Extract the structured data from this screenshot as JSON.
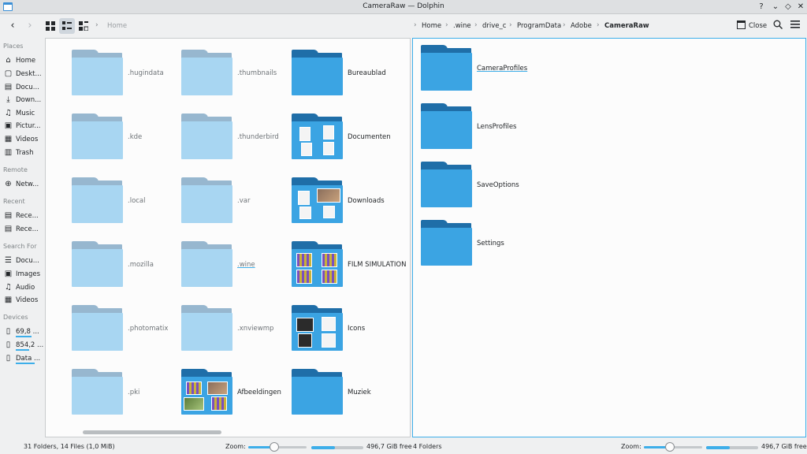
{
  "window": {
    "title": "CameraRaw — Dolphin",
    "buttons": [
      "?",
      "⌄",
      "◇",
      "✕"
    ]
  },
  "toolbar": {
    "back_icon": "‹",
    "forward_icon": "›",
    "home_crumb": "Home",
    "breadcrumb": [
      "Home",
      ".wine",
      "drive_c",
      "ProgramData",
      "Adobe",
      "CameraRaw"
    ],
    "close_label": "Close"
  },
  "sidebar": {
    "places_header": "Places",
    "places": [
      {
        "label": "Home",
        "icon": "home-icon"
      },
      {
        "label": "Deskt...",
        "icon": "desktop-icon"
      },
      {
        "label": "Docu...",
        "icon": "documents-icon"
      },
      {
        "label": "Down...",
        "icon": "downloads-icon"
      },
      {
        "label": "Music",
        "icon": "music-icon"
      },
      {
        "label": "Pictur...",
        "icon": "pictures-icon"
      },
      {
        "label": "Videos",
        "icon": "videos-icon"
      },
      {
        "label": "Trash",
        "icon": "trash-icon"
      }
    ],
    "remote_header": "Remote",
    "remote": [
      {
        "label": "Netw...",
        "icon": "network-icon"
      }
    ],
    "recent_header": "Recent",
    "recent": [
      {
        "label": "Rece...",
        "icon": "recent-files-icon"
      },
      {
        "label": "Rece...",
        "icon": "recent-locations-icon"
      }
    ],
    "search_header": "Search For",
    "search": [
      {
        "label": "Docu...",
        "icon": "documents-icon"
      },
      {
        "label": "Images",
        "icon": "images-icon"
      },
      {
        "label": "Audio",
        "icon": "audio-icon"
      },
      {
        "label": "Videos",
        "icon": "videos-icon"
      }
    ],
    "devices_header": "Devices",
    "devices": [
      {
        "label": "69,8 ...",
        "icon": "drive-icon",
        "usage": 0.6
      },
      {
        "label": "854,2 ...",
        "icon": "drive-icon",
        "usage": 0.5
      },
      {
        "label": "Data ...",
        "icon": "drive-icon",
        "usage": 0.7
      }
    ]
  },
  "left_pane": {
    "columns": [
      [
        ".hugindata",
        ".kde",
        ".local",
        ".mozilla",
        ".photomatix",
        ".pki"
      ],
      [
        ".thumbnails",
        ".thunderbird",
        ".var",
        ".wine",
        ".xnviewmp",
        "Afbeeldingen"
      ],
      [
        "Bureaublad",
        "Documenten",
        "Downloads",
        "FILM SIMULATION",
        "Icons",
        "Muziek"
      ]
    ]
  },
  "right_pane": {
    "items": [
      "CameraProfiles",
      "LensProfiles",
      "SaveOptions",
      "Settings"
    ]
  },
  "status_left": {
    "summary": "31 Folders, 14 Files (1,0 MiB)",
    "zoom_label": "Zoom:",
    "zoom_level": 0.45,
    "space_used": 0.45,
    "free": "496,7 GiB free"
  },
  "status_right": {
    "summary": "4 Folders",
    "zoom_label": "Zoom:",
    "zoom_level": 0.45,
    "space_used": 0.45,
    "free": "496,7 GiB free"
  }
}
